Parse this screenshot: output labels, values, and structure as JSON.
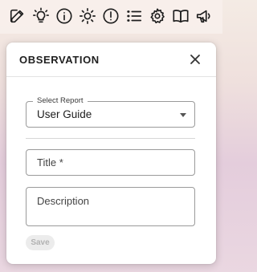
{
  "toolbar": {
    "icons": [
      "edit-icon",
      "lightbulb-icon",
      "info-icon",
      "sun-icon",
      "alert-icon",
      "list-icon",
      "gear-icon",
      "book-icon",
      "megaphone-icon"
    ]
  },
  "modal": {
    "title": "OBSERVATION",
    "report_select": {
      "label": "Select Report",
      "value": "User Guide"
    },
    "title_field": {
      "placeholder": "Title *"
    },
    "description_field": {
      "placeholder": "Description"
    },
    "save_label": "Save",
    "save_disabled": true
  }
}
